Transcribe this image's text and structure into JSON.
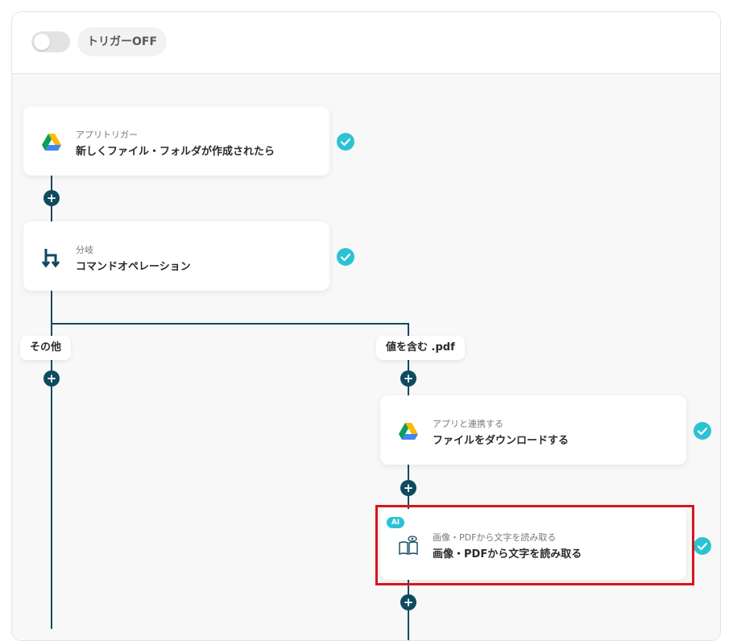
{
  "header": {
    "trigger_label": "トリガーOFF"
  },
  "flow": {
    "step1": {
      "subtitle": "アプリトリガー",
      "title": "新しくファイル・フォルダが作成されたら",
      "icon": "google-drive-icon"
    },
    "step2": {
      "subtitle": "分岐",
      "title": "コマンドオペレーション",
      "icon": "branch-icon"
    },
    "branches": {
      "left_label": "その他",
      "right_label": "値を含む .pdf"
    },
    "step3": {
      "subtitle": "アプリと連携する",
      "title": "ファイルをダウンロードする",
      "icon": "google-drive-icon"
    },
    "step4": {
      "badge": "AI",
      "subtitle": "画像・PDFから文字を読み取る",
      "title": "画像・PDFから文字を読み取る",
      "icon": "book-eye-icon"
    }
  },
  "colors": {
    "accent": "#2bc3d3",
    "line": "#0f4a5f",
    "highlight": "#d7161d"
  }
}
